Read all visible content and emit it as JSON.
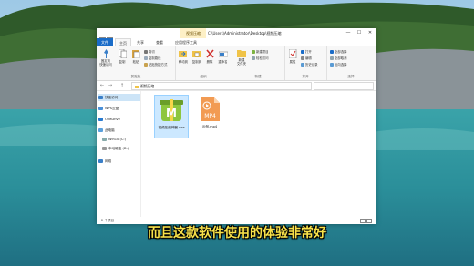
{
  "window": {
    "title_path": "C:\\Users\\Administrator\\Desktop\\视频压缩",
    "tool_tab": "视频压缩",
    "controls": {
      "minimize": "—",
      "maximize": "☐",
      "close": "✕"
    }
  },
  "tabs": {
    "file": "文件",
    "home": "主页",
    "share": "共享",
    "view": "查看",
    "manage": "应用程序工具"
  },
  "ribbon": {
    "pin_label": "固定到\n快速访问",
    "copy_label": "复制",
    "paste_label": "粘贴",
    "cut_label": "剪切",
    "copy_path_label": "复制路径",
    "paste_shortcut_label": "粘贴快捷方式",
    "move_to_label": "移动到",
    "copy_to_label": "复制到",
    "delete_label": "删除",
    "rename_label": "重命名",
    "new_folder_label": "新建\n文件夹",
    "new_item_label": "新建项目",
    "easy_access_label": "轻松访问",
    "properties_label": "属性",
    "open_label": "打开",
    "edit_label": "编辑",
    "history_label": "历史记录",
    "select_all_label": "全部选择",
    "select_none_label": "全部取消",
    "invert_label": "反向选择",
    "group_clipboard": "剪贴板",
    "group_organize": "组织",
    "group_new": "新建",
    "group_open": "打开",
    "group_select": "选择"
  },
  "address": {
    "back": "←",
    "forward": "→",
    "up": "↑",
    "path": "视频压缩",
    "search_placeholder": ""
  },
  "nav": {
    "quick_access": "快速访问",
    "wps": "WPS云盘",
    "onedrive": "OneDrive",
    "this_pc": "此电脑",
    "drive_c": "Win10 (C:)",
    "drive_d": "本地磁盘 (D:)",
    "network": "网络"
  },
  "files": [
    {
      "name": "视频压缩神器.exe",
      "icon": "app-icon"
    },
    {
      "name": "示例.mp4",
      "icon": "mp4-icon"
    }
  ],
  "status": {
    "count": "2 个项目"
  },
  "subtitle": "而且这款软件使用的体验非常好",
  "colors": {
    "accent": "#1a6cc8",
    "subtitle": "#f7e14a",
    "folder": "#f0c348",
    "mp4": "#f29b53",
    "app": "#8dc63f"
  }
}
